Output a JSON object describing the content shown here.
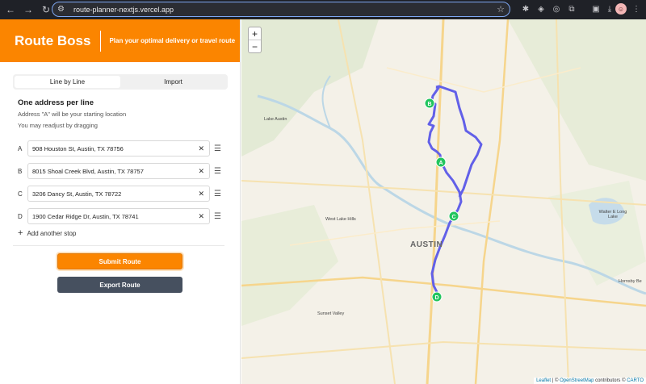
{
  "browser": {
    "url": "route-planner-nextjs.vercel.app"
  },
  "header": {
    "brand": "Route Boss",
    "tagline": "Plan your optimal delivery or travel route"
  },
  "tabs": [
    {
      "label": "Line by Line",
      "active": true
    },
    {
      "label": "Import",
      "active": false
    }
  ],
  "instructions": {
    "title": "One address per line",
    "hint1": "Address \"A\" will be your starting location",
    "hint2": "You may readjust by dragging"
  },
  "stops": [
    {
      "letter": "A",
      "address": "908 Houston St, Austin, TX 78756"
    },
    {
      "letter": "B",
      "address": "8015 Shoal Creek Blvd, Austin, TX 78757"
    },
    {
      "letter": "C",
      "address": "3206 Dancy St, Austin, TX 78722"
    },
    {
      "letter": "D",
      "address": "1900 Cedar Ridge Dr, Austin, TX 78741"
    }
  ],
  "add_stop_label": "Add another stop",
  "buttons": {
    "submit": "Submit Route",
    "export": "Export Route"
  },
  "map": {
    "zoom_in": "+",
    "zoom_out": "−",
    "labels": {
      "lake_austin": "Lake Austin",
      "west_lake_hills": "West Lake Hills",
      "austin": "AUSTIN",
      "sunset_valley": "Sunset Valley",
      "walter_long_lake": "Walter E Long Lake",
      "hornsby_bend": "Hornsby Be"
    },
    "markers": [
      "A",
      "B",
      "C",
      "D"
    ],
    "route_color": "#6260e8",
    "marker_color": "#22c55e",
    "attribution": {
      "leaflet": "Leaflet",
      "sep": " | © ",
      "osm": "OpenStreetMap",
      "contrib": " contributors © ",
      "carto": "CARTO"
    }
  },
  "colors": {
    "brand": "#fb8500",
    "export_button": "#46505f"
  }
}
